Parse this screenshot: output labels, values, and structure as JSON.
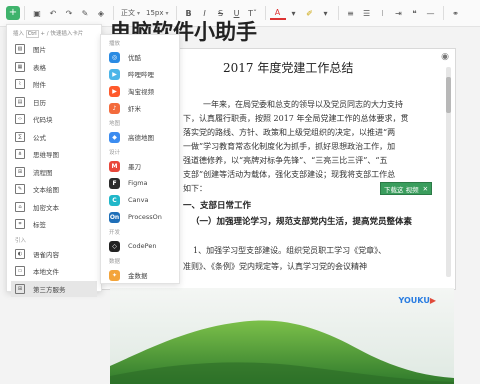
{
  "toolbar": {
    "style_value": "正文",
    "size_value": "15px",
    "bold": "B",
    "italic": "I",
    "strike": "S",
    "underline": "U",
    "font_color": "A"
  },
  "page_title": "电脑软件小助手",
  "insert_panel": {
    "head_prefix": "插入",
    "head_key": "Ctrl",
    "head_suffix": "+ / 快速插入卡片",
    "items": [
      {
        "label": "图片",
        "icon": "image-icon"
      },
      {
        "label": "表格",
        "icon": "table-icon"
      },
      {
        "label": "附件",
        "icon": "paperclip-icon"
      },
      {
        "label": "日历",
        "icon": "calendar-icon"
      },
      {
        "label": "代码块",
        "icon": "code-icon"
      },
      {
        "label": "公式",
        "icon": "formula-icon"
      },
      {
        "label": "思维导图",
        "icon": "mindmap-icon"
      },
      {
        "label": "流程图",
        "icon": "flowchart-icon"
      },
      {
        "label": "文本绘图",
        "icon": "text-diagram-icon"
      },
      {
        "label": "加密文本",
        "icon": "lock-icon"
      },
      {
        "label": "标签",
        "icon": "tag-icon"
      }
    ],
    "section_label": "引入",
    "import_items": [
      {
        "label": "语雀内容",
        "icon": "yuque-icon"
      },
      {
        "label": "本地文件",
        "icon": "file-icon"
      },
      {
        "label": "第三方服务",
        "icon": "grid-icon"
      }
    ]
  },
  "third_panel": {
    "sections": [
      {
        "label": "播放",
        "items": [
          {
            "label": "优酷",
            "icon": "youku-icon",
            "color": "#2a8be3",
            "glyph": "◎"
          },
          {
            "label": "哔哩哔哩",
            "icon": "bilibili-icon",
            "color": "#4cb5e8",
            "glyph": "▶"
          },
          {
            "label": "淘宝视频",
            "icon": "taobao-video-icon",
            "color": "#ff5a2c",
            "glyph": "▶"
          },
          {
            "label": "虾米",
            "icon": "xiami-icon",
            "color": "#f36b3c",
            "glyph": "♪"
          }
        ]
      },
      {
        "label": "地图",
        "items": [
          {
            "label": "高德地图",
            "icon": "amap-icon",
            "color": "#3b8cf0",
            "glyph": "◆"
          }
        ]
      },
      {
        "label": "设计",
        "items": [
          {
            "label": "墨刀",
            "icon": "modao-icon",
            "color": "#e8473b",
            "glyph": "M"
          },
          {
            "label": "Figma",
            "icon": "figma-icon",
            "color": "#2b2b2b",
            "glyph": "F"
          },
          {
            "label": "Canva",
            "icon": "canva-icon",
            "color": "#20b7c9",
            "glyph": "C"
          },
          {
            "label": "ProcessOn",
            "icon": "processon-icon",
            "color": "#1f6fb8",
            "glyph": "On"
          }
        ]
      },
      {
        "label": "开发",
        "items": [
          {
            "label": "CodePen",
            "icon": "codepen-icon",
            "color": "#222222",
            "glyph": "◇"
          }
        ]
      },
      {
        "label": "数据",
        "items": [
          {
            "label": "金数据",
            "icon": "jinshuju-icon",
            "color": "#f3a43a",
            "glyph": "✦"
          }
        ]
      }
    ]
  },
  "document": {
    "title": "2017 年度党建工作总结",
    "paragraph_lines": [
      "一年来，在局党委和总支的领导以及党员同志的大力支持",
      "下，认真履行职责，按照 2017 年全局党建工作的总体要求，贯",
      "落实党的路线、方针、政策和上级党组织的决定，以推进“两",
      "一做”学习教育常态化制度化为抓手，抓好思想政治工作，加",
      "强道德修养，以“亮牌对标争先锋”、“三亮三比三评”、“五",
      "支部”创建等活动为载体，强化支部建设；现我将支部工作总",
      "如下："
    ],
    "heading1": "一、支部日常工作",
    "heading2": "（一）加强理论学习，规范支部党内生活，提高党员整体素",
    "bottom_lines": [
      "1、加强学习型支部建设。组织党员职工学习《党章》、",
      "准则》、《条例》党内规定等，认真学习党的会议精神"
    ]
  },
  "download_bar": {
    "label": "下载这 视频",
    "close": "✕"
  },
  "video": {
    "logo_a": "YOUKU",
    "logo_b": "▶"
  }
}
